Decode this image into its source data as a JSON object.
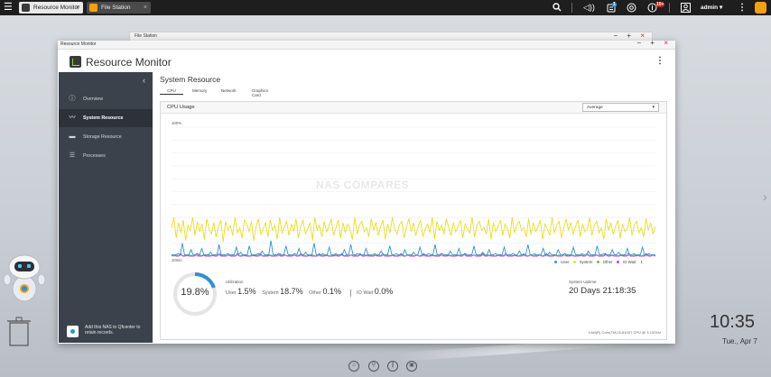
{
  "taskbar": {
    "tabs": [
      {
        "label": "Resource Monitor",
        "close": "×"
      },
      {
        "label": "File Station",
        "close": "×"
      }
    ],
    "notification_badge": "1",
    "alert_badge": "10+",
    "user": "admin ▾"
  },
  "file_station_window": {
    "title": "File Station",
    "controls": [
      "−",
      "+",
      "×"
    ]
  },
  "resource_monitor_window": {
    "title": "Resource Monitor",
    "app_name": "Resource Monitor",
    "controls": [
      "−",
      "+",
      "×"
    ],
    "menu_icon": "⋮"
  },
  "sidebar": {
    "collapse": "‹",
    "items": [
      {
        "label": "Overview",
        "icon": "overview-icon",
        "glyph": "ⓘ"
      },
      {
        "label": "System Resource",
        "icon": "system-resource-icon",
        "glyph": "〰"
      },
      {
        "label": "Storage Resource",
        "icon": "storage-icon",
        "glyph": "▬"
      },
      {
        "label": "Processes",
        "icon": "processes-icon",
        "glyph": "☰"
      }
    ],
    "promo": "Add this NAS to Qfcenter to retain records."
  },
  "main": {
    "title": "System Resource",
    "tabs": [
      "CPU",
      "Memory",
      "Network",
      "Graphics Card"
    ],
    "active_tab": "CPU",
    "panel_title": "CPU Usage",
    "select_value": "Average",
    "select_caret": "▾"
  },
  "chart_data": {
    "type": "line",
    "y_top_label": "100%",
    "x_left_label": "10min",
    "ylim": [
      0,
      100
    ],
    "watermark": "NAS COMPARES",
    "legend": [
      {
        "name": "User",
        "color": "#2e8fd6"
      },
      {
        "name": "System",
        "color": "#e8de1e"
      },
      {
        "name": "Other",
        "color": "#6abf3b"
      },
      {
        "name": "IO Wait",
        "color": "#c640c6"
      }
    ],
    "legend_end": "1",
    "series": [
      {
        "name": "User",
        "color": "#2e8fd6",
        "values": [
          1,
          1,
          1,
          2,
          1,
          10,
          1,
          1,
          1,
          5,
          1,
          1,
          2,
          1,
          6,
          1,
          1,
          1,
          3,
          1,
          1,
          1,
          9,
          1,
          1,
          1,
          2,
          1,
          1,
          1,
          7,
          1,
          3,
          1,
          1,
          1,
          8,
          1,
          1,
          1,
          2,
          1,
          4,
          1,
          1,
          1,
          12,
          1,
          1,
          1,
          2,
          1,
          1,
          8,
          1,
          1,
          1,
          2,
          1,
          6,
          1,
          1,
          3,
          1,
          1,
          1,
          10,
          1,
          1,
          1,
          2,
          1,
          1,
          7,
          1,
          1,
          2,
          1,
          1,
          1,
          5,
          1,
          1,
          9,
          1,
          1,
          2,
          1,
          1,
          1,
          6,
          1,
          1,
          1,
          2,
          1,
          1,
          4,
          1,
          1,
          1,
          8,
          1,
          1,
          2,
          1,
          1,
          1,
          5,
          1,
          1,
          1,
          3,
          1,
          1,
          7,
          1,
          1,
          1,
          2,
          1,
          1,
          9,
          1,
          1,
          2,
          1,
          1,
          1,
          4,
          1,
          1,
          1,
          6,
          1,
          1,
          2,
          1,
          1,
          1,
          8,
          1,
          1,
          1,
          3,
          1,
          1,
          5,
          1,
          1,
          2,
          1,
          1,
          1,
          7,
          1,
          1,
          1,
          2,
          1,
          1,
          4,
          1,
          1,
          1,
          9,
          1,
          1,
          2,
          1,
          1,
          1,
          6,
          1,
          1,
          3,
          1,
          1,
          1,
          5,
          1,
          1,
          2,
          1,
          1,
          1,
          7,
          1,
          1,
          1,
          2,
          1,
          1,
          4,
          1,
          1,
          1,
          8,
          1,
          1,
          2,
          1,
          1,
          1,
          5,
          1,
          1,
          3,
          1,
          1,
          1,
          6,
          1,
          1,
          2,
          1,
          1,
          1,
          7,
          1,
          1,
          2,
          1,
          1,
          1
        ]
      },
      {
        "name": "System",
        "color": "#e8de1e",
        "values": [
          22,
          30,
          14,
          26,
          18,
          28,
          12,
          24,
          20,
          30,
          16,
          27,
          19,
          25,
          13,
          29,
          21,
          17,
          26,
          15,
          23,
          28,
          11,
          27,
          20,
          24,
          16,
          30,
          18,
          22,
          14,
          28,
          25,
          19,
          27,
          12,
          23,
          29,
          17,
          21,
          26,
          15,
          28,
          20,
          24,
          13,
          30,
          18,
          22,
          27,
          16,
          25,
          19,
          29,
          14,
          23,
          28,
          17,
          21,
          26,
          12,
          30,
          20,
          24,
          15,
          27,
          19,
          23,
          29,
          16,
          22,
          28,
          14,
          26,
          18,
          25,
          21,
          13,
          30,
          17,
          24,
          27,
          19,
          22,
          15,
          29,
          20,
          26,
          16,
          23,
          28,
          13,
          25,
          18,
          30,
          21,
          17,
          24,
          27,
          14,
          22,
          29,
          19,
          26,
          16,
          23,
          28,
          15,
          21,
          25,
          18,
          30,
          13,
          27,
          20,
          24,
          17,
          29,
          22,
          16,
          26,
          19,
          23,
          28,
          14,
          25,
          21,
          18,
          30,
          15,
          24,
          27,
          20,
          22,
          17,
          29,
          13,
          26,
          19,
          23,
          28,
          16,
          25,
          21,
          14,
          30,
          18,
          24,
          27,
          20,
          22,
          15,
          29,
          17,
          26,
          19,
          23,
          28,
          13,
          25,
          21,
          16,
          30,
          18,
          24,
          27,
          14,
          22,
          29,
          20,
          26,
          17,
          23,
          28,
          15,
          25,
          19,
          21,
          30,
          16,
          24,
          27,
          18,
          22,
          13,
          29,
          20,
          26,
          17,
          23,
          28,
          14,
          25,
          19,
          21,
          30,
          16,
          24,
          27,
          18,
          22,
          15,
          29,
          20,
          26,
          17,
          23
        ]
      },
      {
        "name": "Other",
        "color": "#6abf3b",
        "values": [
          1,
          0,
          1,
          0,
          1,
          0,
          1,
          0,
          1,
          0,
          1,
          0,
          1,
          0,
          1,
          0,
          1,
          0,
          1,
          0,
          1,
          0,
          1,
          0,
          1,
          0,
          1,
          0,
          1,
          0,
          1,
          0,
          1,
          0,
          1,
          0,
          1,
          0,
          1,
          0,
          1,
          0,
          1,
          0,
          1,
          0,
          1,
          0,
          1,
          0,
          1,
          0,
          1,
          0,
          1,
          0,
          1,
          0,
          1,
          0,
          1,
          0,
          1,
          0,
          1,
          0,
          1,
          0,
          1,
          0,
          1,
          0,
          1,
          0,
          1,
          0,
          1,
          0,
          1,
          0,
          1,
          0,
          1,
          0,
          1,
          0,
          1,
          0,
          1,
          0,
          1,
          0,
          1,
          0,
          1,
          0,
          1,
          0,
          1,
          0,
          1,
          0,
          1,
          0,
          1,
          0,
          1,
          0,
          1,
          0,
          1,
          0,
          1,
          0,
          1,
          0,
          1,
          0,
          1,
          0,
          1,
          0,
          1,
          0,
          1,
          0,
          1,
          0,
          1,
          0,
          1,
          0,
          1,
          0,
          1,
          0,
          1,
          0,
          1,
          0,
          1,
          0,
          1,
          0,
          1,
          0,
          1,
          0,
          1,
          0,
          1,
          0,
          1,
          0,
          1,
          0,
          1,
          0,
          1,
          0,
          1,
          0,
          1,
          0,
          1,
          0,
          1,
          0,
          1,
          0,
          1,
          0,
          1,
          0,
          1,
          0,
          1,
          0,
          1,
          0,
          1,
          0,
          1,
          0,
          1,
          0,
          1,
          0,
          1,
          0,
          1,
          0,
          1,
          0,
          1,
          0,
          1,
          0,
          1,
          0,
          1,
          0,
          1,
          0,
          1,
          0
        ]
      },
      {
        "name": "IO Wait",
        "color": "#c640c6",
        "values": [
          0,
          1,
          0,
          0,
          2,
          0,
          0,
          1,
          0,
          0,
          0,
          2,
          0,
          0,
          1,
          0,
          0,
          0,
          1,
          0,
          0,
          2,
          0,
          0,
          0,
          1,
          0,
          0,
          0,
          2,
          0,
          0,
          1,
          0,
          0,
          0,
          1,
          0,
          0,
          2,
          0,
          0,
          0,
          1,
          0,
          0,
          0,
          2,
          0,
          0,
          1,
          0,
          0,
          0,
          1,
          0,
          0,
          2,
          0,
          0,
          0,
          1,
          0,
          0,
          0,
          2,
          0,
          0,
          1,
          0,
          0,
          0,
          1,
          0,
          0,
          2,
          0,
          0,
          0,
          1,
          0,
          0,
          0,
          2,
          0,
          0,
          1,
          0,
          0,
          0,
          1,
          0,
          0,
          2,
          0,
          0,
          0,
          1,
          0,
          0,
          0,
          2,
          0,
          0,
          1,
          0,
          0,
          0,
          1,
          0,
          0,
          2,
          0,
          0,
          0,
          1,
          0,
          0,
          0,
          2,
          0,
          0,
          1,
          0,
          0,
          0,
          1,
          0,
          0,
          2,
          0,
          0,
          0,
          1,
          0,
          0,
          0,
          2,
          0,
          0,
          1,
          0,
          0,
          0,
          1,
          0,
          0,
          2,
          0,
          0,
          0,
          1,
          0,
          0,
          0,
          2,
          0,
          0,
          1,
          0,
          0,
          0,
          1,
          0,
          0,
          2,
          0,
          0,
          0,
          1,
          0,
          0,
          0,
          2,
          0,
          0,
          1,
          0,
          0,
          0,
          1,
          0,
          0,
          2,
          0,
          0,
          0,
          1,
          0,
          0,
          0,
          2,
          0,
          0,
          1,
          0,
          0,
          0,
          1,
          0,
          0,
          2,
          0,
          0,
          0,
          1,
          0,
          0,
          0,
          2,
          0,
          0,
          1,
          0
        ]
      }
    ]
  },
  "stats": {
    "utilization": "19.8%",
    "utilization_fraction": 0.198,
    "caption": "Utilization",
    "user_label": "User",
    "user_value": "1.5%",
    "system_label": "System",
    "system_value": "18.7%",
    "other_label": "Other",
    "other_value": "0.1%",
    "iowait_label": "IO Wait",
    "iowait_value": "0.0%",
    "uptime_caption": "System Uptime",
    "uptime_value": "20 Days 21:18:35",
    "cpu_name": "Intel(R) Core(TM) i3-8100T CPU @ 3.10GHz"
  },
  "desktop": {
    "time": "10:35",
    "date": "Tue., Apr 7",
    "next_arrow": "›"
  },
  "colors": {
    "accent": "#2e8fd6",
    "sidebar": "#3c424b",
    "close_red": "#d0231b",
    "orange": "#f5a10e"
  }
}
